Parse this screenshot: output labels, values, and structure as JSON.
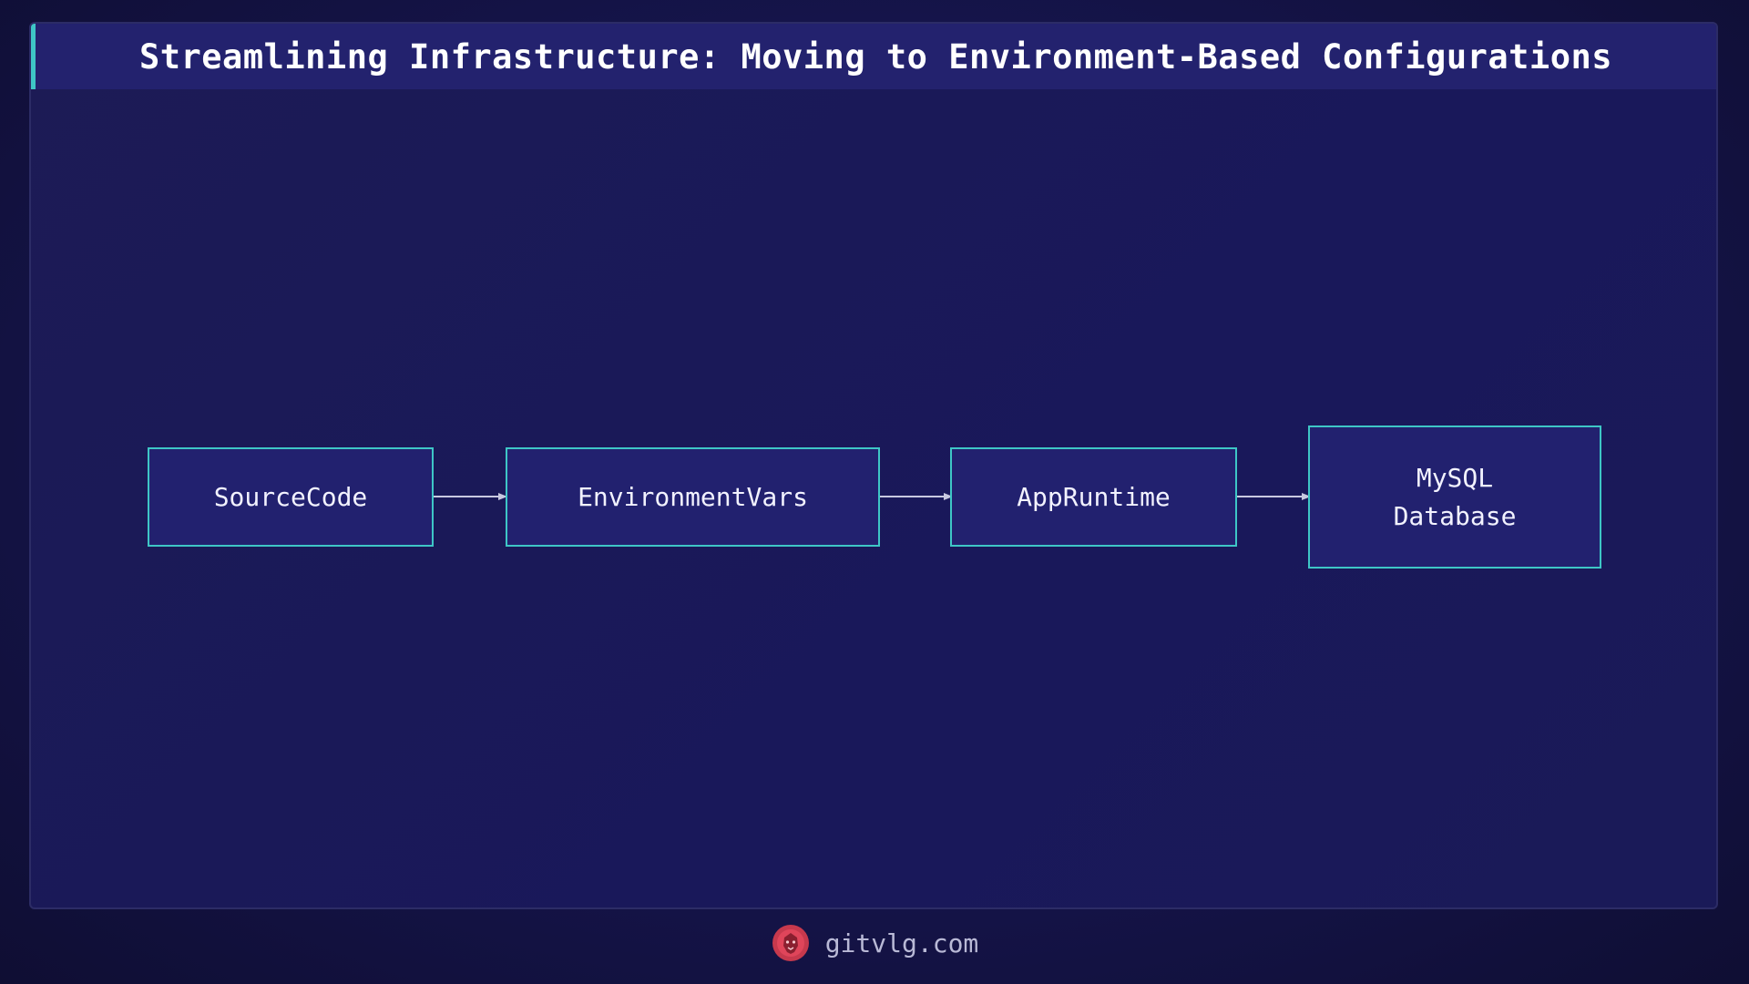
{
  "header": {
    "title": "Streamlining Infrastructure: Moving to Environment-Based Configurations"
  },
  "diagram": {
    "nodes": [
      {
        "id": "source",
        "label": "SourceCode"
      },
      {
        "id": "envvars",
        "label": "EnvironmentVars"
      },
      {
        "id": "runtime",
        "label": "AppRuntime"
      },
      {
        "id": "mysql",
        "label": "MySQL\nDatabase"
      }
    ],
    "edges": [
      {
        "from": "source",
        "to": "envvars"
      },
      {
        "from": "envvars",
        "to": "runtime"
      },
      {
        "from": "runtime",
        "to": "mysql"
      }
    ]
  },
  "footer": {
    "site": "gitvlg.com",
    "logo_icon": "lion-head-icon"
  },
  "colors": {
    "background": "#121138",
    "panel": "#1c1b55",
    "node_fill": "#22216f",
    "node_border": "#3ec6c6",
    "accent": "#3ec6c6",
    "edge": "#c8c8e0",
    "logo": "#e0455a"
  }
}
